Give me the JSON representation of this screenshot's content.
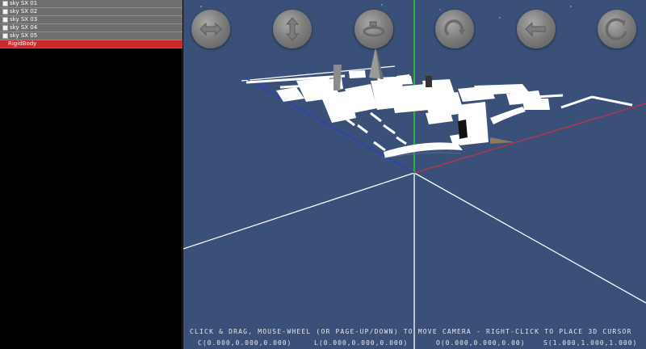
{
  "scene_tree": {
    "items": [
      {
        "label": "sky SX 01",
        "checked": true
      },
      {
        "label": "sky SX 02",
        "checked": true
      },
      {
        "label": "sky SX 03",
        "checked": true
      },
      {
        "label": "sky SX 04",
        "checked": true
      },
      {
        "label": "sky SX 05",
        "checked": true
      }
    ],
    "selected_item": "RigidBody"
  },
  "toolbar": {
    "buttons": [
      {
        "name": "pan-horizontal-button",
        "icon": "pan-horizontal-icon"
      },
      {
        "name": "pan-vertical-button",
        "icon": "pan-vertical-icon"
      },
      {
        "name": "orbit-horizontal-button",
        "icon": "orbit-horizontal-icon"
      },
      {
        "name": "rotate-button",
        "icon": "rotate-icon"
      },
      {
        "name": "turn-button",
        "icon": "turn-icon"
      },
      {
        "name": "zoom-button",
        "icon": "zoom-icon"
      }
    ]
  },
  "viewport": {
    "background_color": "#3a5078",
    "axis_colors": {
      "x": "#c0304a",
      "y": "#22dd22",
      "z": "#2a3fc4",
      "grid": "#ffffff"
    },
    "hint": "CLICK & DRAG, MOUSE-WHEEL (OR PAGE-UP/DOWN) TO MOVE CAMERA - RIGHT-CLICK TO PLACE 3D CURSOR",
    "readouts": {
      "camera": "C(0.000,0.000,0.000)",
      "look": "L(0.000,0.000,0.000)",
      "origin": "O(0.000,0.000,0.00)",
      "scale": "S(1.000,1.000,1.000)"
    }
  }
}
